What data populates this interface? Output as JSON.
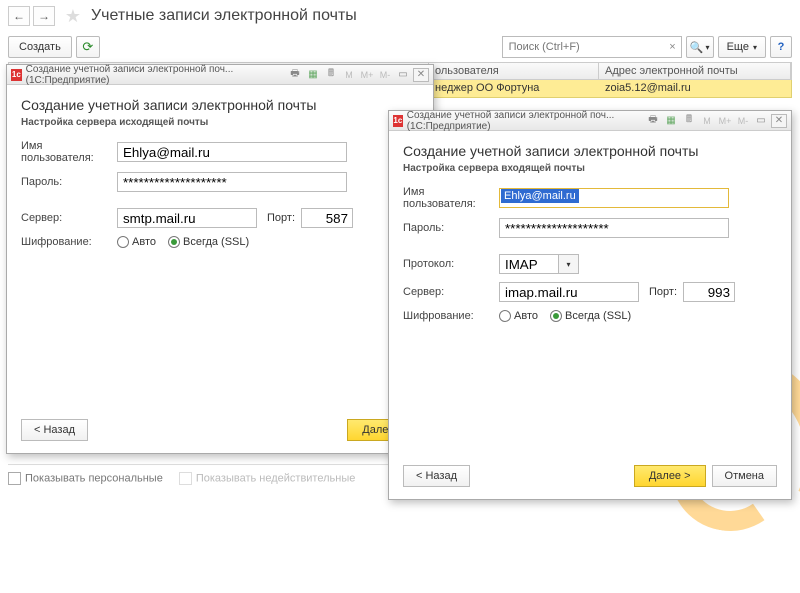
{
  "header": {
    "title": "Учетные записи электронной почты"
  },
  "toolbar": {
    "create": "Создать",
    "search_placeholder": "Поиск (Ctrl+F)",
    "more": "Еще",
    "help": "?"
  },
  "grid": {
    "col_user": "ользователя",
    "col_email": "Адрес электронной почты",
    "row_user": "неджер ОО Фортуна",
    "row_email": "zoia5.12@mail.ru"
  },
  "dialog1": {
    "wintitle": "Создание учетной записи электронной поч... (1С:Предприятие)",
    "title": "Создание учетной записи электронной почты",
    "subtitle": "Настройка сервера исходящей почты",
    "user_label": "Имя пользователя:",
    "user_value": "Ehlya@mail.ru",
    "pass_label": "Пароль:",
    "pass_value": "********************",
    "server_label": "Сервер:",
    "server_value": "smtp.mail.ru",
    "port_label": "Порт:",
    "port_value": "587",
    "enc_label": "Шифрование:",
    "enc_auto": "Авто",
    "enc_always": "Всегда (SSL)",
    "back": "< Назад",
    "next": "Далее >"
  },
  "dialog2": {
    "wintitle": "Создание учетной записи электронной поч... (1С:Предприятие)",
    "title": "Создание учетной записи электронной почты",
    "subtitle": "Настройка сервера входящей почты",
    "user_label": "Имя пользователя:",
    "user_value": "Ehlya@mail.ru",
    "pass_label": "Пароль:",
    "pass_value": "********************",
    "proto_label": "Протокол:",
    "proto_value": "IMAP",
    "server_label": "Сервер:",
    "server_value": "imap.mail.ru",
    "port_label": "Порт:",
    "port_value": "993",
    "enc_label": "Шифрование:",
    "enc_auto": "Авто",
    "enc_always": "Всегда (SSL)",
    "back": "< Назад",
    "next": "Далее >",
    "cancel": "Отмена"
  },
  "footer": {
    "show_personal": "Показывать персональные",
    "show_invalid": "Показывать недействительные"
  }
}
